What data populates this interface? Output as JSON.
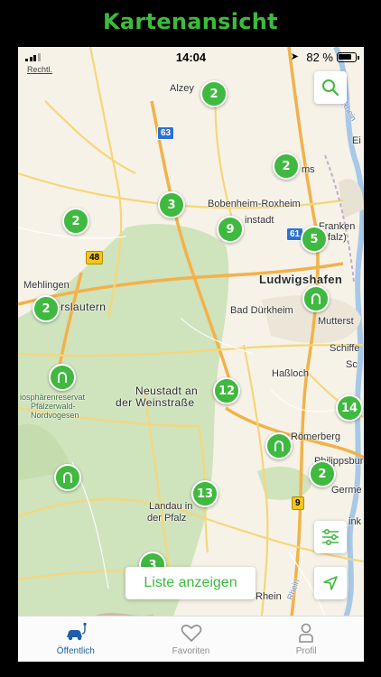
{
  "header": {
    "title": "Kartenansicht"
  },
  "status_bar": {
    "time": "14:04",
    "battery": "82 %"
  },
  "map": {
    "legal_label": "Rechtl.",
    "cities": {
      "alzey": "Alzey",
      "worms": "ms",
      "bobenheim": "Bobenheim-Roxheim",
      "frankenthal_a": "Franken",
      "frankenthal_b": "falz)",
      "einstadt": "instadt",
      "ei": "Ei",
      "mehlingen": "Mehlingen",
      "kaiserslautern": "erslautern",
      "ludwigshafen": "Ludwigshafen",
      "bad_durkheim": "Bad Dürkheim",
      "mutterstadt": "Mutterst",
      "schiffer": "Schiffe",
      "sc": "Sc",
      "hassloch": "Haßloch",
      "neustadt_1": "Neustadt an",
      "neustadt_2": "der Weinstraße",
      "biosphere_1": "iosphärenreservat",
      "biosphere_2": "Pfälzerwald-",
      "biosphere_3": "Nordvogesen",
      "romerberg": "Römerberg",
      "philippsburg": "Philippsburg",
      "germersheim": "Germe",
      "landau_1": "Landau in",
      "landau_2": "der Pfalz",
      "rhein": "Rhein",
      "ink": "ink",
      "rhein_river_1": "Rhein",
      "rhein_river_2": "Rhein"
    },
    "roads": {
      "a63": "63",
      "a61": "61",
      "b48": "48",
      "b9": "9"
    },
    "clusters": {
      "alzey": "2",
      "worms": "2",
      "west": "2",
      "mid_north": "3",
      "einstadt": "9",
      "frankenthal": "5",
      "kaiserslautern": "2",
      "neustadt": "12",
      "east": "14",
      "philippsburg": "2",
      "landau": "13",
      "bottom": "3"
    }
  },
  "buttons": {
    "list": "Liste anzeigen"
  },
  "tabs": [
    {
      "label": "Öffentlich"
    },
    {
      "label": "Favoriten"
    },
    {
      "label": "Profil"
    }
  ],
  "colors": {
    "brand_green": "#3fb93f",
    "tab_active": "#1e5fa8"
  },
  "icons": [
    "search-icon",
    "filter-icon",
    "location-arrow-icon",
    "charging-station-icon",
    "ev-car-icon",
    "heart-icon",
    "person-icon"
  ]
}
